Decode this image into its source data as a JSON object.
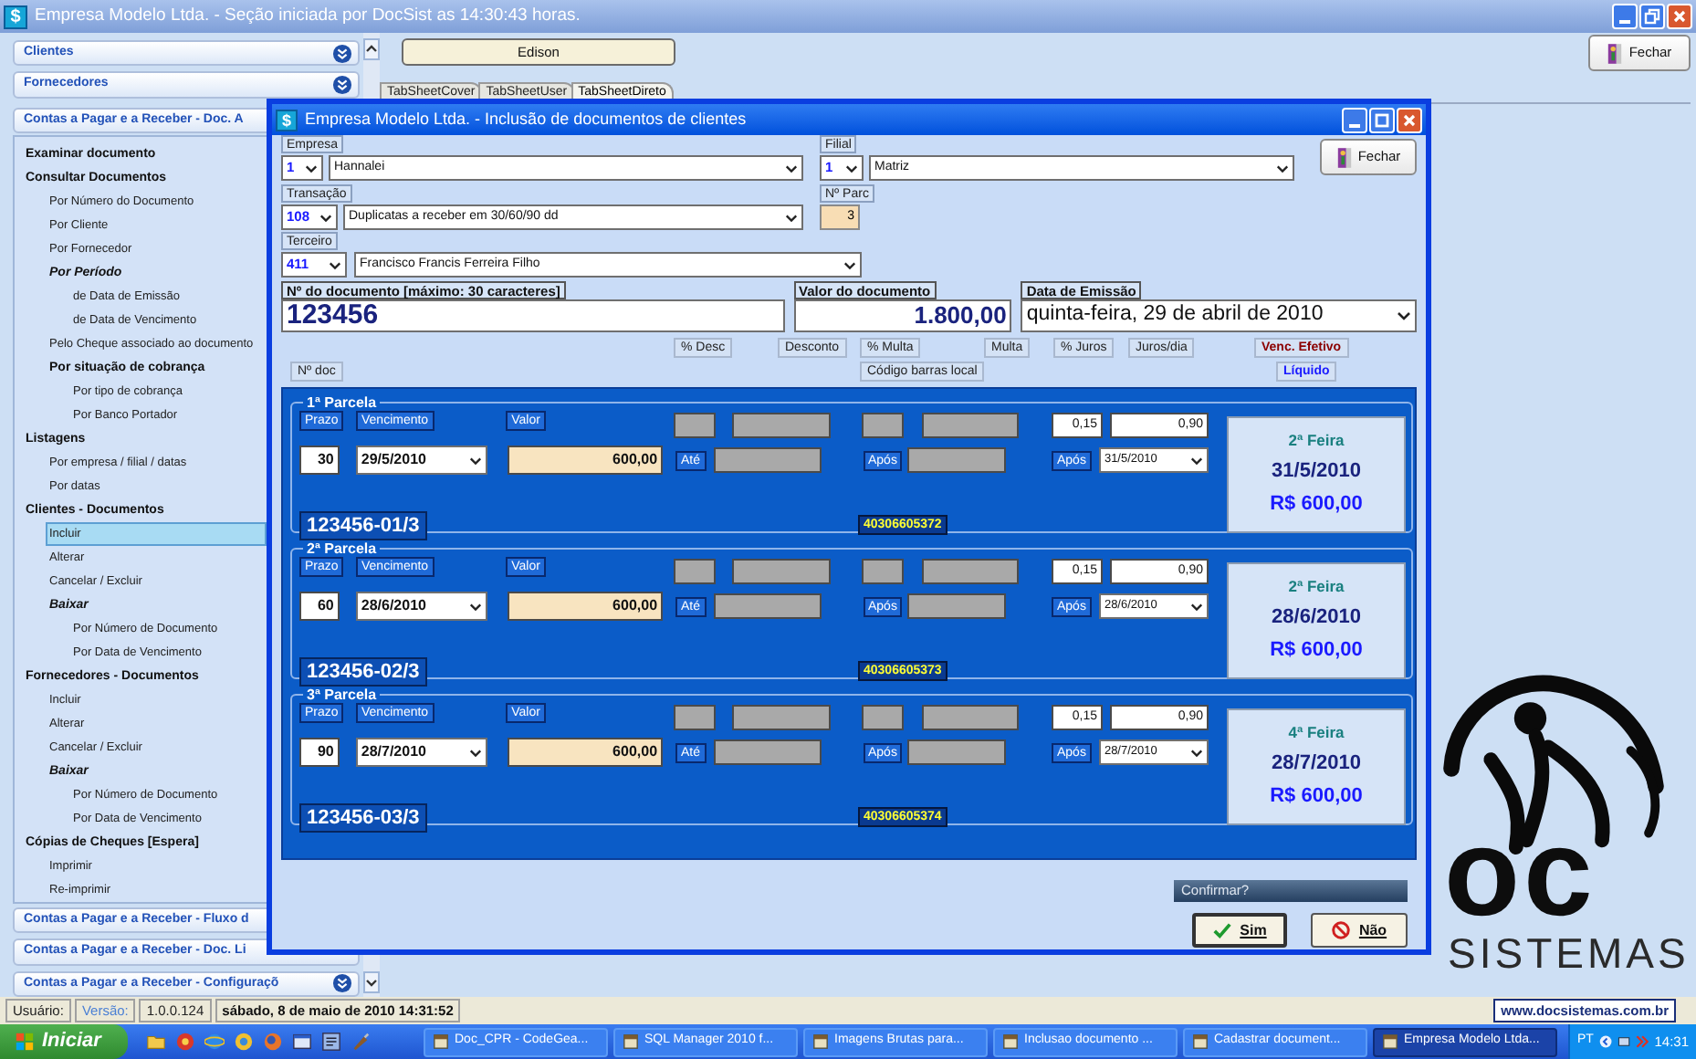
{
  "app_window": {
    "icon": "$",
    "title": "Empresa Modelo Ltda. -  Seção iniciada por DocSist as 14:30:43 horas."
  },
  "sidebar": {
    "collapsed_sections_top": [
      {
        "label": "Clientes"
      },
      {
        "label": "Fornecedores"
      }
    ],
    "open_section": {
      "label": "Contas a Pagar e a Receber - Doc. A",
      "items": [
        {
          "label": "Examinar documento",
          "kind": "group",
          "selected": false
        },
        {
          "label": "Consultar Documentos",
          "kind": "group",
          "selected": false,
          "children": [
            {
              "label": "Por Número do Documento",
              "kind": "link",
              "selected": false
            },
            {
              "label": "Por Cliente",
              "kind": "link",
              "selected": false
            },
            {
              "label": "Por Fornecedor",
              "kind": "link",
              "selected": false
            },
            {
              "label": "Por Período",
              "kind": "emphasis",
              "selected": false,
              "children": [
                {
                  "label": "de Data de Emissão",
                  "kind": "link",
                  "selected": false
                },
                {
                  "label": "de Data de Vencimento",
                  "kind": "link",
                  "selected": false
                }
              ]
            },
            {
              "label": "Pelo Cheque associado ao documento",
              "kind": "link",
              "selected": false
            },
            {
              "label": "Por situação de cobrança",
              "kind": "group",
              "selected": false,
              "children": [
                {
                  "label": "Por tipo de cobrança",
                  "kind": "link",
                  "selected": false
                },
                {
                  "label": "Por Banco Portador",
                  "kind": "link",
                  "selected": false
                }
              ]
            }
          ]
        },
        {
          "label": "Listagens",
          "kind": "group",
          "selected": false,
          "children": [
            {
              "label": "Por empresa / filial / datas",
              "kind": "link",
              "selected": false
            },
            {
              "label": "Por datas",
              "kind": "link",
              "selected": false
            }
          ]
        },
        {
          "label": "Clientes - Documentos",
          "kind": "group",
          "selected": false,
          "children": [
            {
              "label": "Incluir",
              "kind": "link",
              "selected": true
            },
            {
              "label": "Alterar",
              "kind": "link",
              "selected": false
            },
            {
              "label": "Cancelar / Excluir",
              "kind": "link",
              "selected": false
            },
            {
              "label": "Baixar",
              "kind": "emphasis",
              "selected": false,
              "children": [
                {
                  "label": "Por Número de Documento",
                  "kind": "link",
                  "selected": false
                },
                {
                  "label": "Por Data de Vencimento",
                  "kind": "link",
                  "selected": false
                }
              ]
            }
          ]
        },
        {
          "label": "Fornecedores - Documentos",
          "kind": "group",
          "selected": false,
          "children": [
            {
              "label": "Incluir",
              "kind": "link",
              "selected": false
            },
            {
              "label": "Alterar",
              "kind": "link",
              "selected": false
            },
            {
              "label": "Cancelar / Excluir",
              "kind": "link",
              "selected": false
            },
            {
              "label": "Baixar",
              "kind": "emphasis",
              "selected": false,
              "children": [
                {
                  "label": "Por Número de Documento",
                  "kind": "link",
                  "selected": false
                },
                {
                  "label": "Por Data de Vencimento",
                  "kind": "link",
                  "selected": false
                }
              ]
            }
          ]
        },
        {
          "label": "Cópias de Cheques [Espera]",
          "kind": "group",
          "selected": false,
          "children": [
            {
              "label": "Imprimir",
              "kind": "link",
              "selected": false
            },
            {
              "label": "Re-imprimir",
              "kind": "link",
              "selected": false
            }
          ]
        }
      ]
    },
    "collapsed_sections_bottom": [
      {
        "label": "Contas a Pagar e a Receber - Fluxo d"
      },
      {
        "label": "Contas a Pagar e a Receber - Doc. Li"
      },
      {
        "label": "Contas a Pagar e a Receber - Configuraçõ"
      }
    ]
  },
  "toolbar": {
    "user_button": "Edison",
    "close_button": "Fechar"
  },
  "tabs": [
    {
      "label": "TabSheetCover",
      "selected": false
    },
    {
      "label": "TabSheetUser",
      "selected": false
    },
    {
      "label": "TabSheetDireto",
      "selected": true
    }
  ],
  "dialog": {
    "icon": "$",
    "title": "Empresa Modelo Ltda. - Inclusão de documentos de clientes",
    "empresa": {
      "label": "Empresa",
      "code": "1",
      "value": "Hannalei"
    },
    "filial": {
      "label": "Filial",
      "code": "1",
      "value": "Matriz"
    },
    "transacao": {
      "label": "Transação",
      "code": "108",
      "value": "Duplicatas a receber em 30/60/90 dd"
    },
    "parcelas": {
      "label": "Nº Parc",
      "value": "3"
    },
    "terceiro": {
      "label": "Terceiro",
      "code": "411",
      "value": "Francisco Francis Ferreira Filho"
    },
    "close_button": "Fechar",
    "documento": {
      "label": "Nº do documento [máximo: 30 caracteres]",
      "value": "123456"
    },
    "valor": {
      "label": "Valor do documento",
      "value": "1.800,00"
    },
    "emissao": {
      "label": "Data de Emissão",
      "value": "quinta-feira, 29 de abril de 2010"
    },
    "column_headers_top": [
      {
        "label": "% Desc",
        "kind": "plain"
      },
      {
        "label": "Desconto",
        "kind": "plain"
      },
      {
        "label": "% Multa",
        "kind": "plain"
      },
      {
        "label": "Multa",
        "kind": "plain"
      },
      {
        "label": "% Juros",
        "kind": "plain"
      },
      {
        "label": "Juros/dia",
        "kind": "plain"
      },
      {
        "label": "Venc. Efetivo",
        "kind": "due"
      }
    ],
    "column_headers_bottom": [
      {
        "label": "Nº doc",
        "kind": "plain"
      },
      {
        "label": "Código barras local",
        "kind": "plain"
      },
      {
        "label": "Líquido",
        "kind": "net"
      }
    ],
    "installments": [
      {
        "title": "1ª Parcela",
        "prazo_label": "Prazo",
        "vencimento_label": "Vencimento",
        "valor_label": "Valor",
        "prazo": "30",
        "vencimento": "29/5/2010",
        "valor": "600,00",
        "ate_label": "Até",
        "apos_label": "Após",
        "percent_juros": "0,15",
        "juros_dia": "0,90",
        "juros_apos_label": "Após",
        "venc_efetivo": "31/5/2010",
        "doc_number": "123456-01/3",
        "barcode": "40306605372",
        "summary": {
          "weekday": "2ª Feira",
          "date": "31/5/2010",
          "amount": "R$ 600,00"
        }
      },
      {
        "title": "2ª Parcela",
        "prazo_label": "Prazo",
        "vencimento_label": "Vencimento",
        "valor_label": "Valor",
        "prazo": "60",
        "vencimento": "28/6/2010",
        "valor": "600,00",
        "ate_label": "Até",
        "apos_label": "Após",
        "percent_juros": "0,15",
        "juros_dia": "0,90",
        "juros_apos_label": "Após",
        "venc_efetivo": "28/6/2010",
        "doc_number": "123456-02/3",
        "barcode": "40306605373",
        "summary": {
          "weekday": "2ª Feira",
          "date": "28/6/2010",
          "amount": "R$ 600,00"
        }
      },
      {
        "title": "3ª Parcela",
        "prazo_label": "Prazo",
        "vencimento_label": "Vencimento",
        "valor_label": "Valor",
        "prazo": "90",
        "vencimento": "28/7/2010",
        "valor": "600,00",
        "ate_label": "Até",
        "apos_label": "Após",
        "percent_juros": "0,15",
        "juros_dia": "0,90",
        "juros_apos_label": "Após",
        "venc_efetivo": "28/7/2010",
        "doc_number": "123456-03/3",
        "barcode": "40306605374",
        "summary": {
          "weekday": "4ª Feira",
          "date": "28/7/2010",
          "amount": "R$ 600,00"
        }
      }
    ],
    "confirm": {
      "prompt": "Confirmar?",
      "yes": "Sim",
      "no": "Não"
    }
  },
  "logo": {
    "text": "oc",
    "subtitle": "SISTEMAS"
  },
  "status_bar": {
    "user_label": "Usuário:",
    "version_label": "Versão:",
    "version": "1.0.0.124",
    "datetime": "sábado, 8 de maio de 2010 14:31:52",
    "website": "www.docsistemas.com.br"
  },
  "taskbar": {
    "start": "Iniciar",
    "tasks": [
      {
        "label": "Doc_CPR - CodeGea...",
        "selected": false
      },
      {
        "label": "SQL Manager 2010 f...",
        "selected": false
      },
      {
        "label": "Imagens Brutas para...",
        "selected": false
      },
      {
        "label": "Inclusao documento ...",
        "selected": false
      },
      {
        "label": "Cadastrar document...",
        "selected": false
      },
      {
        "label": "Empresa Modelo Ltda...",
        "selected": true
      }
    ],
    "language": "PT",
    "clock": "14:31"
  }
}
